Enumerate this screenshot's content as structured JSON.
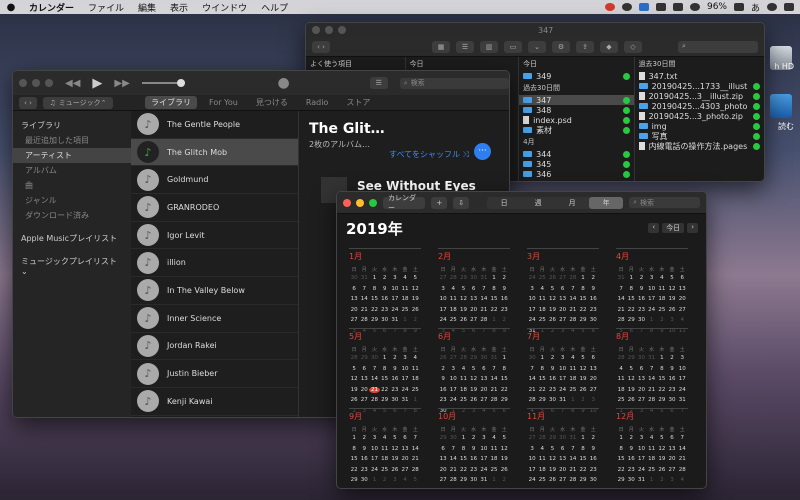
{
  "menubar": {
    "app": "カレンダー",
    "items": [
      "ファイル",
      "編集",
      "表示",
      "ウインドウ",
      "ヘルプ"
    ],
    "battery": "96%",
    "input_mode": "あ"
  },
  "desktop": {
    "hd_label": "h HD",
    "doc_label": "読む"
  },
  "finder": {
    "title": "347",
    "columns": [
      {
        "header": "よく使う項目",
        "rows": []
      },
      {
        "header": "今日",
        "rows": []
      },
      {
        "header": "今日",
        "rows": [
          {
            "name": "349",
            "type": "folder",
            "tag": true
          },
          {
            "name": "過去30日間",
            "type": "header"
          },
          {
            "name": "347",
            "type": "folder",
            "tag": true,
            "sel": true
          },
          {
            "name": "348",
            "type": "folder",
            "tag": true
          },
          {
            "name": "index.psd",
            "type": "file",
            "tag": true
          },
          {
            "name": "素材",
            "type": "folder",
            "tag": true
          },
          {
            "name": "4月",
            "type": "header"
          },
          {
            "name": "344",
            "type": "folder",
            "tag": true
          },
          {
            "name": "345",
            "type": "folder",
            "tag": true
          },
          {
            "name": "346",
            "type": "folder",
            "tag": true
          }
        ]
      },
      {
        "header": "過去30日間",
        "rows": [
          {
            "name": "347.txt",
            "type": "file",
            "tag": false
          },
          {
            "name": "20190425...1733__illust",
            "type": "folder",
            "tag": true
          },
          {
            "name": "20190425...3__illust.zip",
            "type": "file",
            "tag": true
          },
          {
            "name": "20190425...4303_photo",
            "type": "folder",
            "tag": true
          },
          {
            "name": "20190425...3_photo.zip",
            "type": "file",
            "tag": true
          },
          {
            "name": "img",
            "type": "folder",
            "tag": true
          },
          {
            "name": "写真",
            "type": "folder",
            "tag": true
          },
          {
            "name": "内線電話の操作方法.pages",
            "type": "file",
            "tag": true
          }
        ]
      }
    ]
  },
  "music": {
    "breadcrumb": "ミュージック",
    "tabs": [
      "ライブラリ",
      "For You",
      "見つける",
      "Radio",
      "ストア"
    ],
    "search_placeholder": "検索",
    "sidebar": {
      "library_header": "ライブラリ",
      "items": [
        "最近追加した項目",
        "アーティスト",
        "アルバム",
        "曲",
        "ジャンル",
        "ダウンロード済み"
      ],
      "playlists": [
        "Apple Musicプレイリスト",
        "ミュージックプレイリスト ⌄"
      ]
    },
    "artists": [
      "The Gentle People",
      "The Glitch Mob",
      "Goldmund",
      "GRANRODEO",
      "Igor Levit",
      "illion",
      "In The Valley Below",
      "Inner Science",
      "Jordan Rakei",
      "Justin Bieber",
      "Kenji Kawai"
    ],
    "detail": {
      "title": "The Glit…",
      "subtitle": "2枚のアルバム…",
      "shuffle": "すべてをシャッフル",
      "album": "See Without Eyes",
      "more": "···"
    }
  },
  "calendar": {
    "app_button": "カレンダー",
    "add": "+",
    "views": [
      "日",
      "週",
      "月",
      "年"
    ],
    "search_placeholder": "検索",
    "year": "2019年",
    "today_button": "今日",
    "weekdays": [
      "日",
      "月",
      "火",
      "水",
      "木",
      "金",
      "土"
    ],
    "months": [
      "1月",
      "2月",
      "3月",
      "4月",
      "5月",
      "6月",
      "7月",
      "8月",
      "9月",
      "10月",
      "11月",
      "12月"
    ],
    "today_month": 5,
    "today_day": 21
  },
  "colors": {
    "accent": "#2d7ef0",
    "cal_red": "#e5463a",
    "tag_green": "#28c840",
    "folder_blue": "#4aa3ea"
  }
}
